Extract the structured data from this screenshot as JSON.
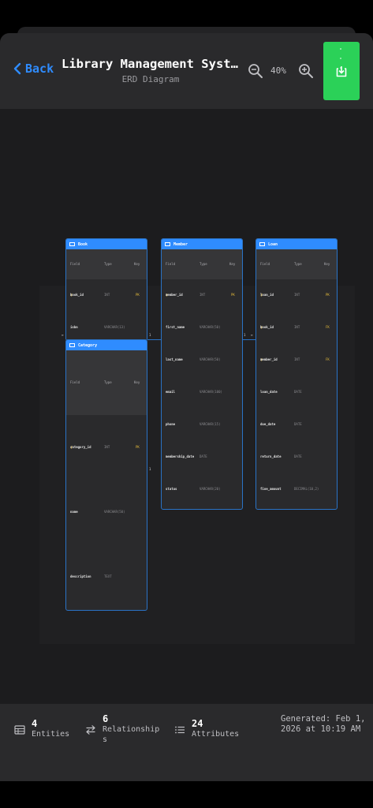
{
  "header": {
    "back_label": "Back",
    "title": "Library Management System",
    "subtitle": "ERD Diagram",
    "zoom_level": "40%"
  },
  "columns": {
    "field": "Field",
    "type": "Type",
    "key": "Key"
  },
  "entities": {
    "book": {
      "name": "Book",
      "fields": [
        {
          "name": "book_id",
          "type": "INT",
          "key": "PK"
        },
        {
          "name": "isbn",
          "type": "VARCHAR(13)",
          "key": ""
        }
      ]
    },
    "category": {
      "name": "Category",
      "fields": [
        {
          "name": "category_id",
          "type": "INT",
          "key": "PK"
        },
        {
          "name": "name",
          "type": "VARCHAR(50)",
          "key": ""
        },
        {
          "name": "description",
          "type": "TEXT",
          "key": ""
        }
      ]
    },
    "member": {
      "name": "Member",
      "fields": [
        {
          "name": "member_id",
          "type": "INT",
          "key": "PK"
        },
        {
          "name": "first_name",
          "type": "VARCHAR(50)",
          "key": ""
        },
        {
          "name": "last_name",
          "type": "VARCHAR(50)",
          "key": ""
        },
        {
          "name": "email",
          "type": "VARCHAR(100)",
          "key": ""
        },
        {
          "name": "phone",
          "type": "VARCHAR(15)",
          "key": ""
        },
        {
          "name": "membership_date",
          "type": "DATE",
          "key": ""
        },
        {
          "name": "status",
          "type": "VARCHAR(20)",
          "key": ""
        }
      ]
    },
    "loan": {
      "name": "Loan",
      "fields": [
        {
          "name": "loan_id",
          "type": "INT",
          "key": "PK"
        },
        {
          "name": "book_id",
          "type": "INT",
          "key": "FK"
        },
        {
          "name": "member_id",
          "type": "INT",
          "key": "FK"
        },
        {
          "name": "loan_date",
          "type": "DATE",
          "key": ""
        },
        {
          "name": "due_date",
          "type": "DATE",
          "key": ""
        },
        {
          "name": "return_date",
          "type": "DATE",
          "key": ""
        },
        {
          "name": "fine_amount",
          "type": "DECIMAL(10,2)",
          "key": ""
        }
      ]
    }
  },
  "cardinality": {
    "left_many": "∞",
    "left_one": "1",
    "middle_one": "1",
    "right_one": "1",
    "right_many": "∞"
  },
  "footer": {
    "entities_count": "4",
    "entities_label": "Entities",
    "relationships_count": "6",
    "relationships_label": "Relationships",
    "attributes_count": "24",
    "attributes_label": "Attributes",
    "generated": "Generated: Feb 1, 2026 at 10:19 AM"
  },
  "colors": {
    "accent": "#2f8cff",
    "export_button": "#2bd158",
    "key_marker": "#e2b93b"
  },
  "icons": {
    "back": "chevron-left-icon",
    "zoom_out": "zoom-out-icon",
    "zoom_in": "zoom-in-icon",
    "export": "export-icon",
    "entity_header": "table-icon",
    "entities": "table-icon",
    "relationships": "swap-arrows-icon",
    "attributes": "list-icon"
  }
}
